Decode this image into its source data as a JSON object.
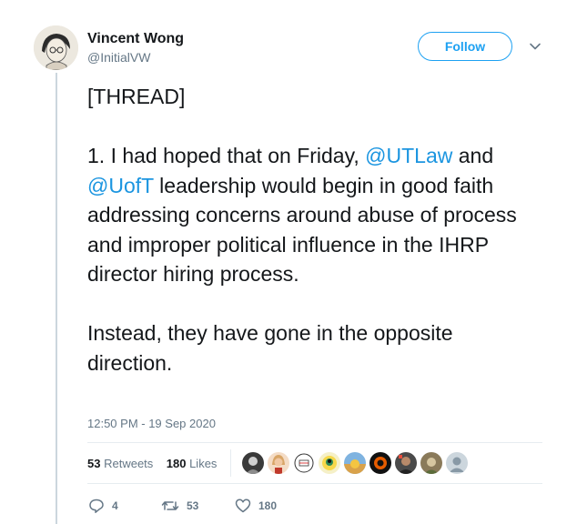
{
  "author": {
    "display_name": "Vincent Wong",
    "handle": "@InitialVW"
  },
  "follow_label": "Follow",
  "tweet": {
    "line_thread": "[THREAD]",
    "p1_start": "1. I had hoped that on Friday, ",
    "mention_1": "@UTLaw",
    "p1_mid": " and ",
    "mention_2": "@UofT",
    "p1_end": " leadership would begin in good faith addressing concerns around abuse of process and improper political influence in the IHRP director hiring process.",
    "p2": "Instead, they have gone in the opposite direction."
  },
  "timestamp": "12:50 PM - 19 Sep 2020",
  "stats": {
    "retweets_count": "53",
    "retweets_label": "Retweets",
    "likes_count": "180",
    "likes_label": "Likes"
  },
  "actions": {
    "reply_count": "4",
    "retweet_count": "53",
    "like_count": "180"
  },
  "colors": {
    "accent": "#1da1f2",
    "mention": "#1b95e0",
    "muted": "#657786",
    "text": "#14171a",
    "divider": "#e6ecf0"
  },
  "icons": [
    "caret-down-icon",
    "reply-icon",
    "retweet-icon",
    "heart-icon"
  ]
}
